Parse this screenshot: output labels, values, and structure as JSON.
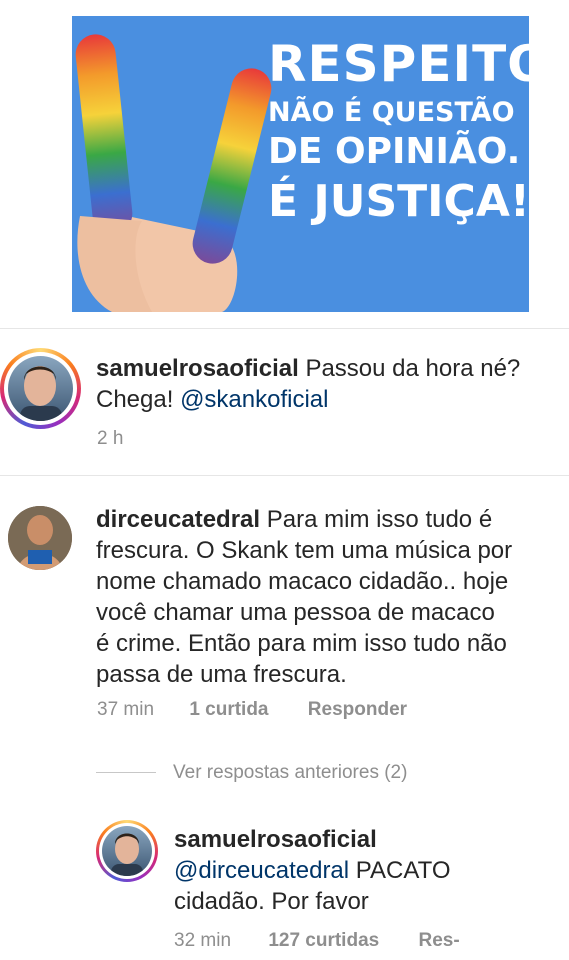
{
  "post": {
    "poster_lines": [
      "RESPEITO",
      "NÃO É QUESTÃO",
      "DE OPINIÃO.",
      "É JUSTIÇA!"
    ]
  },
  "comments": [
    {
      "username": "samuelrosaoficial",
      "text_line1_rest": "Passou da hora né?",
      "text_line2_plain": "Chega! ",
      "mention": "@skankoficial",
      "time": "2 h"
    },
    {
      "username": "dirceucatedral",
      "text_line1_rest": "Para mim isso tudo é",
      "lines": [
        "frescura. O Skank  tem uma música por",
        "nome chamado macaco cidadão.. hoje",
        "você chamar uma pessoa de macaco",
        "é crime. Então para mim isso tudo não",
        "passa de uma frescura."
      ],
      "time": "37 min",
      "likes": "1 curtida",
      "reply": "Responder"
    }
  ],
  "view_replies": "Ver respostas anteriores (2)",
  "reply": {
    "username": "samuelrosaoficial",
    "mention": "@dirceucatedral",
    "line1_rest": " PACATO",
    "line2": "cidadão. Por favor",
    "time": "32 min",
    "likes": "127 curtidas",
    "reply_cut": "Res-"
  }
}
